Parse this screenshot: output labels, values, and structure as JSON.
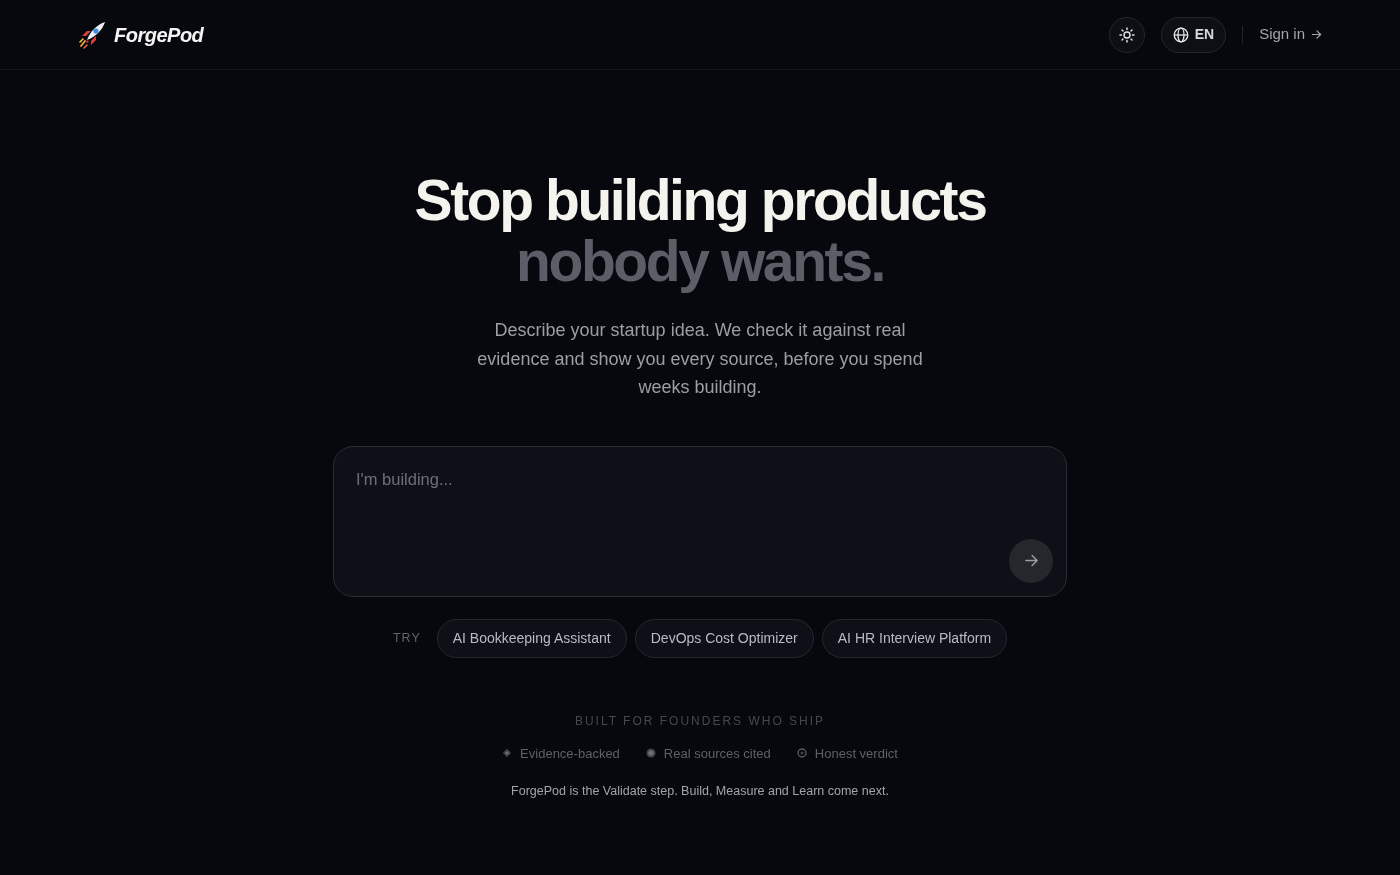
{
  "brand": {
    "name": "ForgePod"
  },
  "nav": {
    "language": "EN",
    "sign_in": "Sign in"
  },
  "hero": {
    "headline": "Stop building products",
    "headline_muted": "nobody wants.",
    "subtitle": "Describe your startup idea. We check it against real evidence and show you every source, before you spend weeks building."
  },
  "idea_input": {
    "placeholder": "I'm building..."
  },
  "suggestions": {
    "label": "TRY",
    "items": [
      "AI Bookkeeping Assistant",
      "DevOps Cost Optimizer",
      "AI HR Interview Platform"
    ]
  },
  "trust": {
    "heading": "BUILT FOR FOUNDERS WHO SHIP",
    "features": [
      {
        "kind": "diamond",
        "label": "Evidence-backed"
      },
      {
        "kind": "dot",
        "label": "Real sources cited"
      },
      {
        "kind": "ring",
        "label": "Honest verdict"
      }
    ],
    "note": "ForgePod is the Validate step. Build, Measure and Learn come next."
  }
}
